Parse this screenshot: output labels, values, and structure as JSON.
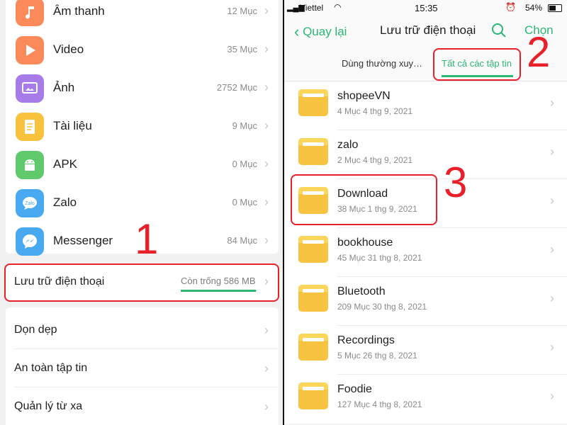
{
  "left": {
    "categories": [
      {
        "label": "Âm thanh",
        "count": "12 Mục",
        "icon": "music-note-icon",
        "color": "#fb8a5b"
      },
      {
        "label": "Video",
        "count": "35 Mục",
        "icon": "play-icon",
        "color": "#fb8a5b"
      },
      {
        "label": "Ảnh",
        "count": "2752 Mục",
        "icon": "image-icon",
        "color": "#a87ce8"
      },
      {
        "label": "Tài liệu",
        "count": "9 Mục",
        "icon": "document-icon",
        "color": "#f9c23c"
      },
      {
        "label": "APK",
        "count": "0 Mục",
        "icon": "android-icon",
        "color": "#5fc96b"
      },
      {
        "label": "Zalo",
        "count": "0 Mục",
        "icon": "zalo-icon",
        "color": "#48a9f0"
      },
      {
        "label": "Messenger",
        "count": "84 Mục",
        "icon": "messenger-icon",
        "color": "#48a9f0"
      }
    ],
    "storage": {
      "label": "Lưu trữ điện thoại",
      "free": "Còn trống 586 MB",
      "used_fraction": 0.99
    },
    "menu": [
      {
        "label": "Dọn dẹp"
      },
      {
        "label": "An toàn tập tin"
      },
      {
        "label": "Quản lý từ xa"
      }
    ]
  },
  "right": {
    "status": {
      "carrier": "Viettel",
      "time": "15:35",
      "battery": "54%"
    },
    "navbar": {
      "back": "Quay lại",
      "title": "Lưu trữ điện thoại",
      "select": "Chọn"
    },
    "tabs": [
      "Dùng thường xuy…",
      "Tất cả các tập tin"
    ],
    "active_tab": 1,
    "files": [
      {
        "name": "shopeeVN",
        "meta": "4 Mục   4 thg 9, 2021"
      },
      {
        "name": "zalo",
        "meta": "2 Mục   4 thg 9, 2021"
      },
      {
        "name": "Download",
        "meta": "38 Mục   1 thg 9, 2021"
      },
      {
        "name": "bookhouse",
        "meta": "45 Mục   31 thg 8, 2021"
      },
      {
        "name": "Bluetooth",
        "meta": "209 Mục   30 thg 8, 2021"
      },
      {
        "name": "Recordings",
        "meta": "5 Mục   26 thg 8, 2021"
      },
      {
        "name": "Foodie",
        "meta": "127 Mục   4 thg 8, 2021"
      }
    ]
  },
  "annotations": [
    "1",
    "2",
    "3"
  ],
  "colors": {
    "accent": "#2bb673",
    "annotation": "#e8202a",
    "folder": "#f7c341"
  }
}
